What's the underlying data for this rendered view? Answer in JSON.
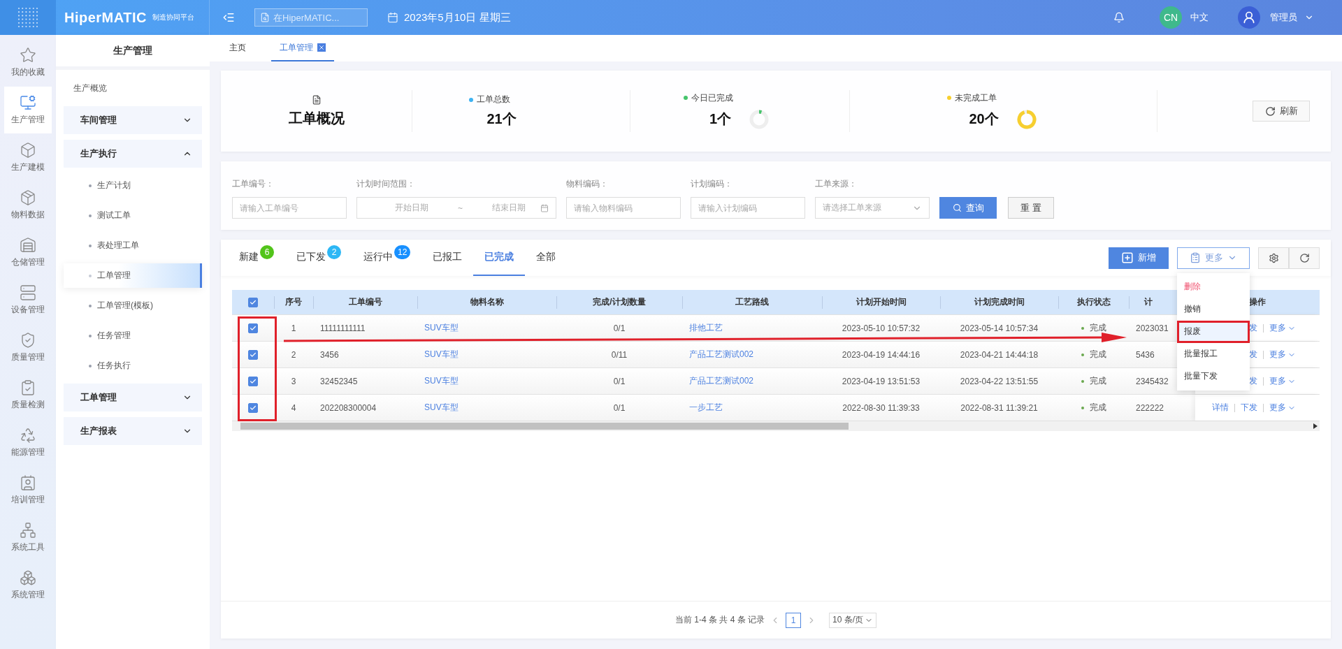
{
  "header": {
    "logo": "HiperMATIC",
    "logo_sub": "制造协同平台",
    "search": {
      "placeholder": "在HiperMATIC..."
    },
    "date": "2023年5月10日 星期三",
    "lang_badge": "CN",
    "language": "中文",
    "user": "管理员"
  },
  "rail": [
    {
      "label": "我的收藏",
      "selected": false
    },
    {
      "label": "生产管理",
      "selected": true
    },
    {
      "label": "生产建模",
      "selected": false
    },
    {
      "label": "物料数据",
      "selected": false
    },
    {
      "label": "仓储管理",
      "selected": false
    },
    {
      "label": "设备管理",
      "selected": false
    },
    {
      "label": "质量管理",
      "selected": false
    },
    {
      "label": "质量检测",
      "selected": false
    },
    {
      "label": "能源管理",
      "selected": false
    },
    {
      "label": "培训管理",
      "selected": false
    },
    {
      "label": "系统工具",
      "selected": false
    },
    {
      "label": "系统管理",
      "selected": false
    }
  ],
  "sidebar": {
    "title": "生产管理",
    "items": [
      {
        "label": "生产概览",
        "kind": "link"
      },
      {
        "label": "车间管理",
        "kind": "group",
        "expanded": false
      },
      {
        "label": "生产执行",
        "kind": "group",
        "expanded": true,
        "children": [
          {
            "label": "生产计划",
            "selected": false
          },
          {
            "label": "测试工单",
            "selected": false
          },
          {
            "label": "表处理工单",
            "selected": false
          },
          {
            "label": "工单管理",
            "selected": true
          },
          {
            "label": "工单管理(模板)",
            "selected": false
          },
          {
            "label": "任务管理",
            "selected": false
          },
          {
            "label": "任务执行",
            "selected": false
          }
        ]
      },
      {
        "label": "工单管理",
        "kind": "group",
        "expanded": false
      },
      {
        "label": "生产报表",
        "kind": "group",
        "expanded": false
      }
    ]
  },
  "page_tabs": [
    {
      "label": "主页",
      "selected": false,
      "closable": false
    },
    {
      "label": "工单管理",
      "selected": true,
      "closable": true
    }
  ],
  "overview": {
    "title": "工单概况",
    "refresh": "刷新",
    "stats": [
      {
        "label": "工单总数",
        "value": "21个",
        "color": "#3db3f2",
        "kind": "plain"
      },
      {
        "label": "今日已完成",
        "value": "1个",
        "color": "#46c46c",
        "kind": "ring"
      },
      {
        "label": "未完成工单",
        "value": "20个",
        "color": "#f7cf2f",
        "kind": "ring"
      }
    ]
  },
  "filters": {
    "fields": [
      {
        "label": "工单编号：",
        "kind": "text",
        "placeholder": "请输入工单编号"
      },
      {
        "label": "计划时间范围：",
        "kind": "daterange",
        "start": "开始日期",
        "separator": "~",
        "end": "结束日期"
      },
      {
        "label": "物料编码：",
        "kind": "text",
        "placeholder": "请输入物料编码"
      },
      {
        "label": "计划编码：",
        "kind": "text",
        "placeholder": "请输入计划编码"
      },
      {
        "label": "工单来源：",
        "kind": "select",
        "placeholder": "请选择工单来源"
      }
    ],
    "query": "查询",
    "reset": "重 置"
  },
  "status_tabs": [
    {
      "label": "新建",
      "count": "6",
      "color": "#52c41a",
      "selected": false
    },
    {
      "label": "已下发",
      "count": "2",
      "color": "#2db7f5",
      "selected": false
    },
    {
      "label": "运行中",
      "count": "12",
      "color": "#1890ff",
      "selected": false
    },
    {
      "label": "已报工",
      "selected": false
    },
    {
      "label": "已完成",
      "selected": true
    },
    {
      "label": "全部",
      "selected": false
    }
  ],
  "actions": {
    "add": "新增",
    "more": "更多"
  },
  "menu": [
    {
      "label": "删除",
      "danger": true,
      "selected": false
    },
    {
      "label": "撤销",
      "danger": false,
      "selected": false
    },
    {
      "label": "报废",
      "danger": false,
      "selected": true
    },
    {
      "label": "批量报工",
      "danger": false,
      "selected": false
    },
    {
      "label": "批量下发",
      "danger": false,
      "selected": false
    }
  ],
  "table": {
    "all_checked": true,
    "columns": [
      "序号",
      "工单编号",
      "物料名称",
      "完成/计划数量",
      "工艺路线",
      "计划开始时间",
      "计划完成时间",
      "执行状态",
      "计",
      "操作"
    ],
    "rows": [
      {
        "checked": true,
        "index": "1",
        "code": "11111111111",
        "material": "SUV车型",
        "qty": "0/1",
        "route": "排他工艺",
        "start": "2023-05-10 10:57:32",
        "end": "2023-05-14 10:57:34",
        "status": "完成",
        "plan": "2023031",
        "ops": [
          "发",
          "更多"
        ]
      },
      {
        "checked": true,
        "index": "2",
        "code": "3456",
        "material": "SUV车型",
        "qty": "0/11",
        "route": "产品工艺测试002",
        "start": "2023-04-19 14:44:16",
        "end": "2023-04-21 14:44:18",
        "status": "完成",
        "plan": "5436",
        "ops": [
          "发",
          "更多"
        ]
      },
      {
        "checked": true,
        "index": "3",
        "code": "32452345",
        "material": "SUV车型",
        "qty": "0/1",
        "route": "产品工艺测试002",
        "start": "2023-04-19 13:51:53",
        "end": "2023-04-22 13:51:55",
        "status": "完成",
        "plan": "2345432",
        "ops": [
          "发",
          "更多"
        ]
      },
      {
        "checked": true,
        "index": "4",
        "code": "202208300004",
        "material": "SUV车型",
        "qty": "0/1",
        "route": "一步工艺",
        "start": "2022-08-30 11:39:33",
        "end": "2022-08-31 11:39:21",
        "status": "完成",
        "plan": "222222",
        "ops": [
          "详情",
          "下发",
          "更多"
        ]
      }
    ]
  },
  "pagination": {
    "summary": "当前 1-4 条 共 4 条 记录",
    "current": "1",
    "page_size": "10 条/页"
  }
}
